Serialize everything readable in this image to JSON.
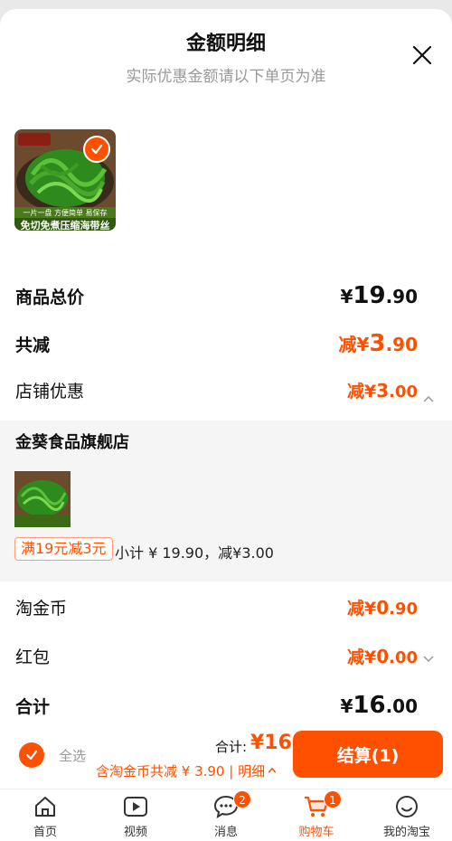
{
  "header": {
    "title": "金额明细",
    "subtitle": "实际优惠金额请以下单页为准"
  },
  "product": {
    "image_caption_top": "一片一盘 方便简单 易保存",
    "image_caption": "免切免煮压缩海带丝"
  },
  "summary": {
    "total_label": "商品总价",
    "total_yen": "¥",
    "total_int": "19",
    "total_dec": ".90",
    "reduce_label": "共减",
    "reduce_pre": "减¥",
    "reduce_int": "3",
    "reduce_dec": ".90",
    "shop_discount_label": "店铺优惠",
    "shop_discount_pre": "减¥",
    "shop_discount_int": "3",
    "shop_discount_dec": ".00"
  },
  "shop": {
    "name": "金葵食品旗舰店",
    "promo": "满19元减3元",
    "subtotal": "小计 ¥ 19.90，减¥3.00"
  },
  "more": {
    "coin_label": "淘金币",
    "coin_pre": "减¥",
    "coin_int": "0",
    "coin_dec": ".90",
    "redpacket_label": "红包",
    "redpacket_pre": "减¥",
    "redpacket_int": "0",
    "redpacket_dec": ".00",
    "sum_label": "合计",
    "sum_yen": "¥",
    "sum_int": "16",
    "sum_dec": ".00"
  },
  "bottom": {
    "select_all": "全选",
    "total_label": "合计:",
    "total_value": "¥16",
    "savings": "含淘金币共减 ¥ 3.90 | 明细",
    "checkout": "结算(1)"
  },
  "tabs": [
    {
      "label": "首页",
      "icon": "home-icon"
    },
    {
      "label": "视频",
      "icon": "video-icon"
    },
    {
      "label": "消息",
      "icon": "message-icon",
      "badge": "2"
    },
    {
      "label": "购物车",
      "icon": "cart-icon",
      "badge": "1"
    },
    {
      "label": "我的淘宝",
      "icon": "profile-icon"
    }
  ],
  "colors": {
    "accent": "#ff5000"
  }
}
